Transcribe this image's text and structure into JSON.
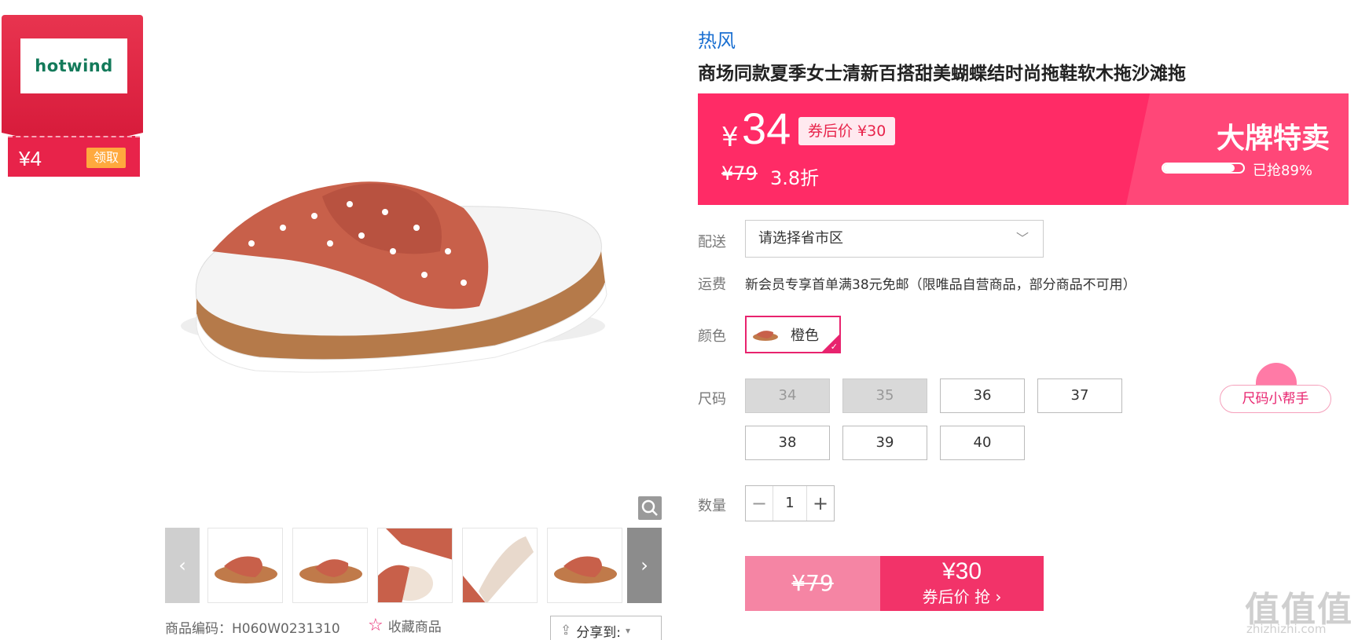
{
  "coupon": {
    "logo_text": "hotwind",
    "amount": "¥4",
    "claim_label": "领取"
  },
  "product": {
    "brand": "热风",
    "title": "商场同款夏季女士清新百搭甜美蝴蝶结时尚拖鞋软木拖沙滩拖",
    "currency": "¥",
    "price": "34",
    "after_coupon": "券后价 ¥30",
    "original_price": "¥79",
    "discount": "3.8折",
    "promo_tag": "大牌特卖",
    "grabbed_text": "已抢89%",
    "grabbed_fraction": 0.89
  },
  "delivery": {
    "label": "配送",
    "placeholder": "请选择省市区"
  },
  "shipping": {
    "label": "运费",
    "text": "新会员专享首单满38元免邮（限唯品自营商品，部分商品不可用）"
  },
  "color": {
    "label": "颜色",
    "selected": "橙色"
  },
  "size": {
    "label": "尺码",
    "options": [
      "34",
      "35",
      "36",
      "37",
      "38",
      "39",
      "40"
    ],
    "disabled": [
      "34",
      "35"
    ],
    "helper": "尺码小帮手"
  },
  "quantity": {
    "label": "数量",
    "minus": "−",
    "value": "1",
    "plus": "+"
  },
  "buy": {
    "original": "¥79",
    "price": "¥30",
    "action": "券后价 抢 ›"
  },
  "gallery": {
    "sku": "商品编码：H060W0231310",
    "favorite": "收藏商品",
    "share": "分享到:",
    "prev": "‹",
    "next": "›"
  },
  "watermark": {
    "main": "值值值",
    "sub": "zhizhizhi.com"
  },
  "colors": {
    "accent": "#ff2b66",
    "brand_blue": "#1a6fd1",
    "coupon_red": "#e8234a"
  }
}
